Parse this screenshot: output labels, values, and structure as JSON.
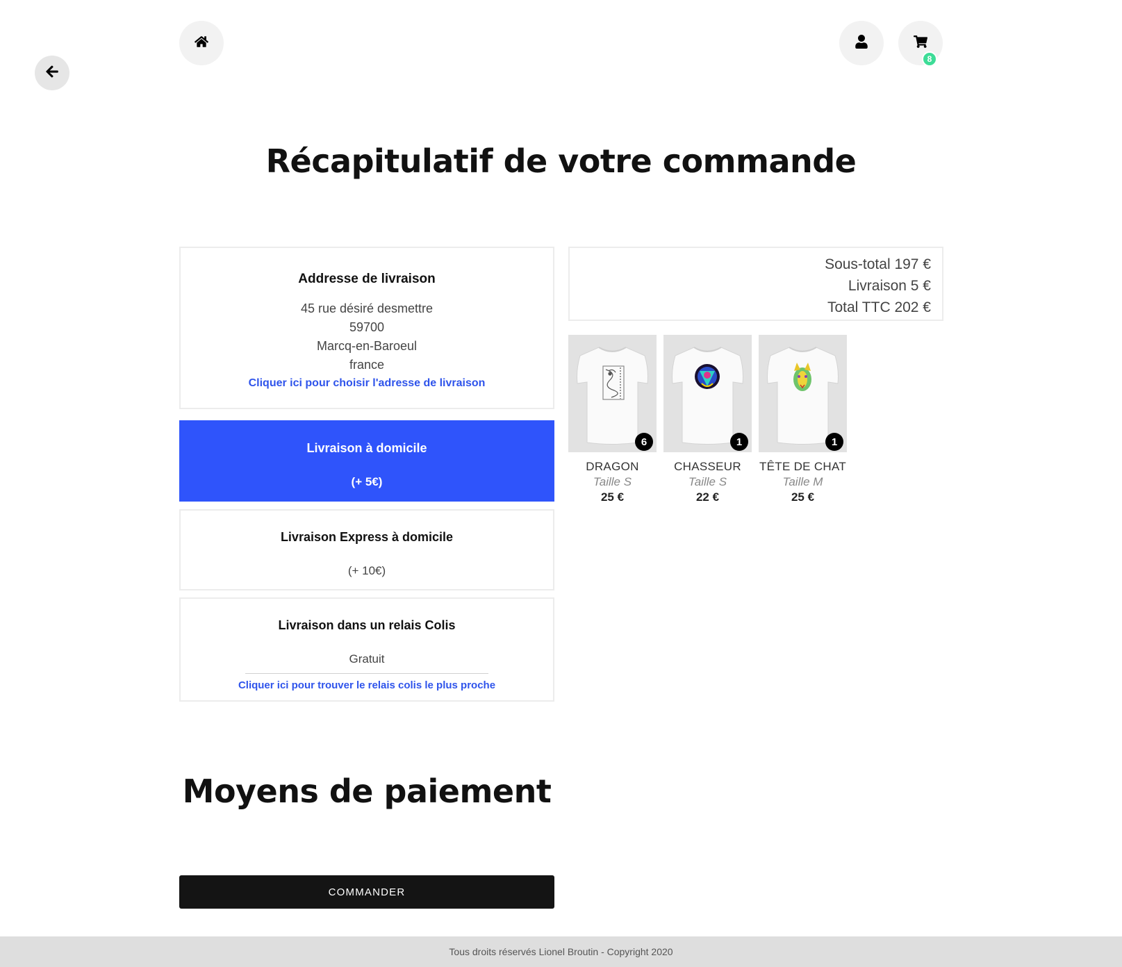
{
  "nav": {
    "back_icon": "arrow-left-icon",
    "home_icon": "home-icon",
    "user_icon": "user-icon",
    "cart_icon": "cart-icon",
    "cart_count": "8"
  },
  "page_title": "Récapitulatif de votre commande",
  "address": {
    "heading": "Addresse de livraison",
    "lines": [
      "45 rue désiré desmettre",
      "59700",
      "Marcq-en-Baroeul",
      "france"
    ],
    "change_link": "Cliquer ici pour choisir l'adresse de livraison"
  },
  "shipping_options": [
    {
      "label": "Livraison à domicile",
      "price": "(+ 5€)",
      "selected": true
    },
    {
      "label": "Livraison Express à domicile",
      "price": "(+ 10€)",
      "selected": false
    },
    {
      "label": "Livraison dans un relais Colis",
      "price": "Gratuit",
      "selected": false,
      "link": "Cliquer ici pour trouver le relais colis le plus proche"
    }
  ],
  "totals": {
    "subtotal": "Sous-total 197 €",
    "shipping": "Livraison 5 €",
    "total": "Total TTC 202 €"
  },
  "products": [
    {
      "name": "DRAGON",
      "size": "Taille S",
      "price": "25 €",
      "qty": "6",
      "print": "dragon"
    },
    {
      "name": "CHASSEUR",
      "size": "Taille S",
      "price": "22 €",
      "qty": "1",
      "print": "hunter"
    },
    {
      "name": "TÊTE DE CHAT",
      "size": "Taille M",
      "price": "25 €",
      "qty": "1",
      "print": "cat"
    }
  ],
  "payment": {
    "heading": "Moyens de paiement"
  },
  "order_button": "COMMANDER",
  "footer": "Tous droits réservés Lionel Broutin - Copyright 2020",
  "colors": {
    "accent": "#2f54fb",
    "badge": "#3ddc97",
    "button": "#141414"
  }
}
